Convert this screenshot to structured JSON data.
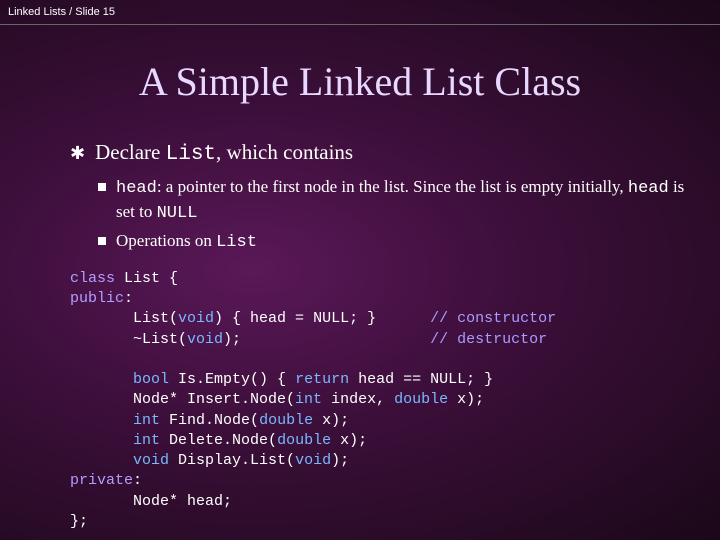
{
  "header": "Linked Lists / Slide 15",
  "title": "A Simple Linked List Class",
  "bullet1_pre": "Declare ",
  "bullet1_code": "List",
  "bullet1_post": ", which contains",
  "sub1_code1": "head",
  "sub1_text1": ": a pointer to the first node in the list. Since the list is empty initially, ",
  "sub1_code2": "head",
  "sub1_text2": " is set to ",
  "sub1_code3": "NULL",
  "sub2_text": "Operations on ",
  "sub2_code": "List",
  "code": {
    "l1a": "class",
    "l1b": " List {",
    "l2a": "public",
    "l2b": ":",
    "l3a": "       List(",
    "l3b": "void",
    "l3c": ") { head = NULL; }      ",
    "l3d": "// constructor",
    "l4a": "       ~List(",
    "l4b": "void",
    "l4c": ");                     ",
    "l4d": "// destructor",
    "l6a": "       ",
    "l6b": "bool",
    "l6c": " Is.Empty() { ",
    "l6d": "return",
    "l6e": " head == NULL; }",
    "l7a": "       Node* Insert.Node(",
    "l7b": "int",
    "l7c": " index, ",
    "l7d": "double",
    "l7e": " x);",
    "l8a": "       ",
    "l8b": "int",
    "l8c": " Find.Node(",
    "l8d": "double",
    "l8e": " x);",
    "l9a": "       ",
    "l9b": "int",
    "l9c": " Delete.Node(",
    "l9d": "double",
    "l9e": " x);",
    "l10a": "       ",
    "l10b": "void",
    "l10c": " Display.List(",
    "l10d": "void",
    "l10e": ");",
    "l11a": "private",
    "l11b": ":",
    "l12": "       Node* head;",
    "l13": "};"
  }
}
